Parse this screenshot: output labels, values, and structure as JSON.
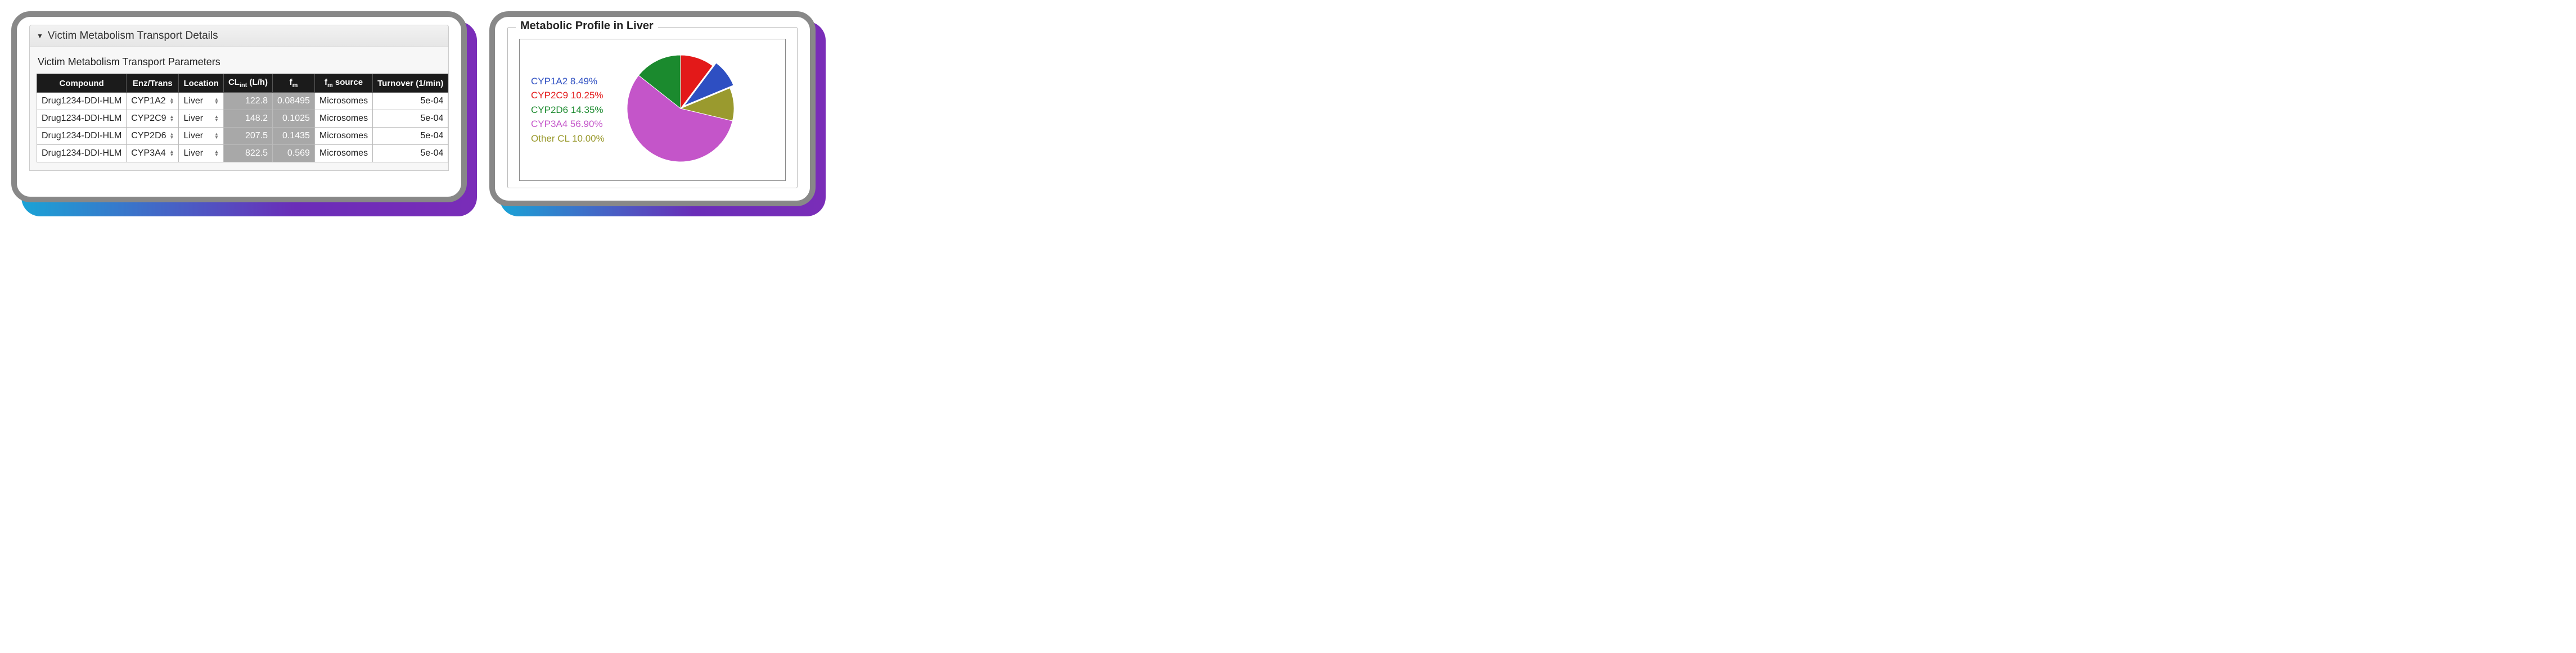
{
  "left": {
    "panelTitle": "Victim Metabolism Transport Details",
    "subhead": "Victim Metabolism Transport Parameters",
    "columns": {
      "compound": "Compound",
      "enz": "Enz/Trans",
      "location": "Location",
      "clint_prefix": "CL",
      "clint_sub": "int",
      "clint_suffix": " (L/h)",
      "fm_prefix": "f",
      "fm_sub": "m",
      "fmsrc_prefix": "f",
      "fmsrc_sub": "m",
      "fmsrc_suffix": " source",
      "turnover": "Turnover (1/min)"
    },
    "rows": [
      {
        "compound": "Drug1234-DDI-HLM",
        "enz": "CYP1A2",
        "location": "Liver",
        "clint": "122.8",
        "fm": "0.08495",
        "fmsrc": "Microsomes",
        "turnover": "5e-04"
      },
      {
        "compound": "Drug1234-DDI-HLM",
        "enz": "CYP2C9",
        "location": "Liver",
        "clint": "148.2",
        "fm": "0.1025",
        "fmsrc": "Microsomes",
        "turnover": "5e-04"
      },
      {
        "compound": "Drug1234-DDI-HLM",
        "enz": "CYP2D6",
        "location": "Liver",
        "clint": "207.5",
        "fm": "0.1435",
        "fmsrc": "Microsomes",
        "turnover": "5e-04"
      },
      {
        "compound": "Drug1234-DDI-HLM",
        "enz": "CYP3A4",
        "location": "Liver",
        "clint": "822.5",
        "fm": "0.569",
        "fmsrc": "Microsomes",
        "turnover": "5e-04"
      }
    ]
  },
  "right": {
    "title": "Metabolic Profile in Liver",
    "legend": [
      {
        "label": "CYP1A2 8.49%",
        "color": "#2e4fc2"
      },
      {
        "label": "CYP2C9 10.25%",
        "color": "#e31919"
      },
      {
        "label": "CYP2D6 14.35%",
        "color": "#1b8a2e"
      },
      {
        "label": "CYP3A4 56.90%",
        "color": "#c455c9"
      },
      {
        "label": "Other CL 10.00%",
        "color": "#9a9a2e"
      }
    ]
  },
  "chart_data": {
    "type": "pie",
    "title": "Metabolic Profile in Liver",
    "series": [
      {
        "name": "CYP1A2",
        "value": 8.49,
        "color": "#2e4fc2"
      },
      {
        "name": "CYP2C9",
        "value": 10.25,
        "color": "#e31919"
      },
      {
        "name": "CYP2D6",
        "value": 14.35,
        "color": "#1b8a2e"
      },
      {
        "name": "CYP3A4",
        "value": 56.9,
        "color": "#c455c9"
      },
      {
        "name": "Other CL",
        "value": 10.0,
        "color": "#9a9a2e"
      }
    ],
    "unit": "%",
    "exploded_slice": "CYP1A2"
  }
}
